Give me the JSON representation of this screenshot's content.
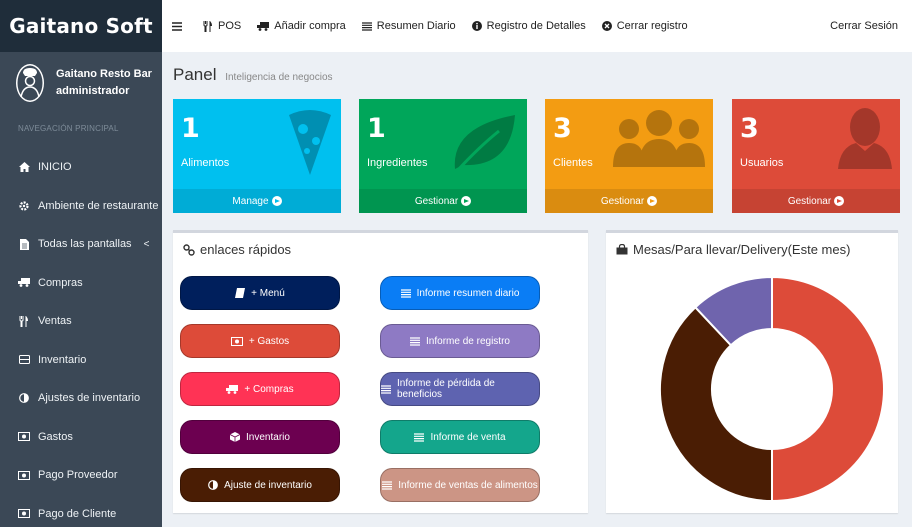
{
  "brand": "Gaitano Soft",
  "user": {
    "name": "Gaitano Resto Bar",
    "role": "administrador"
  },
  "nav_header": "NAVEGACIÓN PRINCIPAL",
  "sidebar": {
    "items": [
      {
        "label": "INICIO",
        "icon": "home-icon"
      },
      {
        "label": "Ambiente de restaurante",
        "icon": "gear-icon"
      },
      {
        "label": "Todas las pantallas",
        "icon": "file-icon"
      },
      {
        "label": "Compras",
        "icon": "truck-icon"
      },
      {
        "label": "Ventas",
        "icon": "cutlery-icon"
      },
      {
        "label": "Inventario",
        "icon": "database-icon"
      },
      {
        "label": "Ajustes de inventario",
        "icon": "adjust-icon"
      },
      {
        "label": "Gastos",
        "icon": "money-icon"
      },
      {
        "label": "Pago Proveedor",
        "icon": "money-icon"
      },
      {
        "label": "Pago de Cliente",
        "icon": "money-icon"
      }
    ],
    "chevron": "<"
  },
  "topbar": {
    "menu_icon": "hamburger-icon",
    "items": [
      {
        "label": "POS",
        "icon": "cutlery-icon"
      },
      {
        "label": "Añadir compra",
        "icon": "truck-icon"
      },
      {
        "label": "Resumen Diario",
        "icon": "list-icon"
      },
      {
        "label": "Registro de Detalles",
        "icon": "info-icon"
      },
      {
        "label": "Cerrar registro",
        "icon": "close-circle-icon"
      }
    ],
    "logout": "Cerrar Sesión"
  },
  "page": {
    "title": "Panel",
    "subtitle": "Inteligencia de negocios"
  },
  "stat_boxes": [
    {
      "count": "1",
      "label": "Alimentos",
      "footer": "Manage",
      "color": "#00c0ef",
      "icon": "pizza-icon"
    },
    {
      "count": "1",
      "label": "Ingredientes",
      "footer": "Gestionar",
      "color": "#00a65a",
      "icon": "leaf-icon"
    },
    {
      "count": "3",
      "label": "Clientes",
      "footer": "Gestionar",
      "color": "#f39c12",
      "icon": "users-icon"
    },
    {
      "count": "3",
      "label": "Usuarios",
      "footer": "Gestionar",
      "color": "#dd4b39",
      "icon": "user-icon"
    }
  ],
  "quick_links": {
    "title": "enlaces rápidos",
    "left": [
      {
        "label": "+ Menú",
        "icon": "book-icon",
        "color": "#001f5c"
      },
      {
        "label": "+ Gastos",
        "icon": "money-icon",
        "color": "#dd4b39"
      },
      {
        "label": "+ Compras",
        "icon": "truck-icon",
        "color": "#ff3355"
      },
      {
        "label": "Inventario",
        "icon": "cube-icon",
        "color": "#6c0050"
      },
      {
        "label": "Ajuste de inventario",
        "icon": "adjust-icon",
        "color": "#4a1d04"
      }
    ],
    "right": [
      {
        "label": "Informe resumen diario",
        "icon": "list-icon",
        "color": "#0a7df5"
      },
      {
        "label": "Informe de registro",
        "icon": "list-icon",
        "color": "#8e7ac4"
      },
      {
        "label": "Informe de pérdida de beneficios",
        "icon": "list-icon",
        "color": "#5e63b0"
      },
      {
        "label": "Informe de venta",
        "icon": "list-icon",
        "color": "#14a68c"
      },
      {
        "label": "Informe de ventas de alimentos",
        "icon": "list-icon",
        "color": "#cc9585"
      }
    ]
  },
  "chart_box": {
    "title": "Mesas/Para llevar/Delivery(Este mes)",
    "icon": "shopping-bag-icon"
  },
  "chart_data": {
    "type": "pie",
    "title": "Mesas/Para llevar/Delivery(Este mes)",
    "slices": [
      {
        "value": 50,
        "color": "#dd4b39"
      },
      {
        "value": 38,
        "color": "#4a1d04"
      },
      {
        "value": 12,
        "color": "#6f64ad"
      }
    ],
    "legend": "none"
  }
}
